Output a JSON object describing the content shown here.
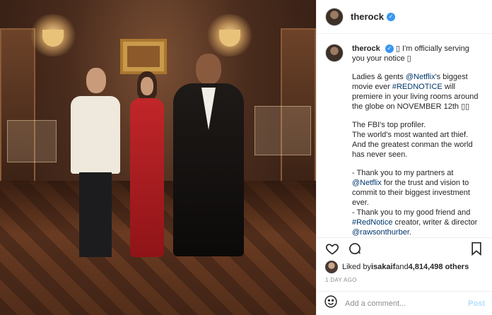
{
  "photo": {
    "alt": "",
    "accent": "#c1262a"
  },
  "header": {
    "username": "therock",
    "verified": true
  },
  "caption": {
    "username": "therock",
    "line1": "I'm officially serving you your notice",
    "para1": "Ladies & gents ",
    "para1_mention": "@Netflix",
    "para1_mid": "'s biggest movie ever ",
    "para1_tag": "#REDNOTICE",
    "para1_end": " will premiere in your living rooms around the globe on NOVEMBER 12th",
    "para2_l1": "The FBI's top profiler.",
    "para2_l2": "The world's most wanted art thief.",
    "para2_l3": "And the greatest conman the world has never seen.",
    "para3_a": "- Thank you to my partners at ",
    "para3_mention": "@Netflix",
    "para3_b": " for the trust and vision to commit to their biggest investment ever.",
    "para3_c": "- Thank you to my good friend and ",
    "para3_tag": "#RedNotice",
    "para3_d": " creator, writer & director ",
    "para3_mention2": "@rawsonthurber",
    "para3_e": "."
  },
  "actions": {
    "like_icon": "heart-icon",
    "comment_icon": "comment-icon",
    "share_icon": "share-icon",
    "save_icon": "bookmark-icon"
  },
  "likes": {
    "prefix": "Liked by ",
    "user": "isakaif",
    "middle": " and ",
    "count": "4,814,498 others"
  },
  "timestamp": "1 DAY AGO",
  "comment_box": {
    "placeholder": "Add a comment...",
    "post_label": "Post"
  },
  "colors": {
    "verified": "#3897f0",
    "link": "#00376b",
    "post_disabled": "#b2dffc"
  }
}
